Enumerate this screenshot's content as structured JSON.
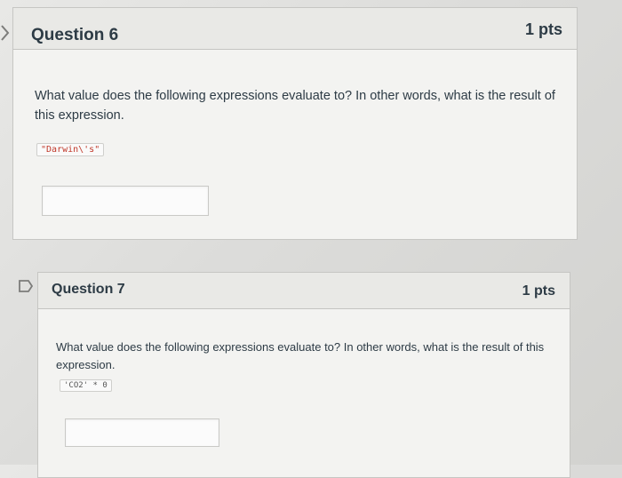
{
  "question6": {
    "title": "Question 6",
    "points": "1 pts",
    "prompt": "What value does the following expressions evaluate to? In other words, what is the result of this expression.",
    "expression": "\"Darwin\\'s\"",
    "answer": ""
  },
  "question7": {
    "title": "Question 7",
    "points": "1 pts",
    "prompt": "What value does the following expressions evaluate to? In other words, what is the result of this expression.",
    "expression": "'CO2' * 0",
    "answer": ""
  },
  "icons": {
    "q6_left": "chevron-right-icon",
    "q7_flag": "bookmark-flag-icon"
  }
}
